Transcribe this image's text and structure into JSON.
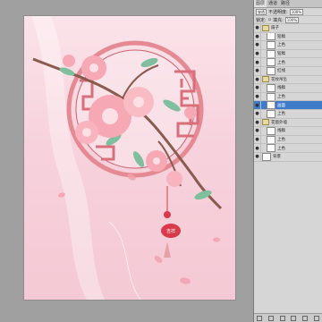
{
  "panel": {
    "tabs": [
      "图层",
      "通道",
      "路径"
    ],
    "blend_mode": "穿透",
    "opacity_label": "不透明度:",
    "opacity_value": "100%",
    "lock_label": "锁定:",
    "fill_label": "填充:",
    "fill_value": "100%",
    "layers": [
      {
        "name": "扇子",
        "type": "group",
        "indent": false,
        "selected": false
      },
      {
        "name": "铅稿",
        "type": "layer",
        "indent": true,
        "selected": false
      },
      {
        "name": "上色",
        "type": "layer",
        "indent": true,
        "selected": false
      },
      {
        "name": "铅稿",
        "type": "layer",
        "indent": true,
        "selected": false
      },
      {
        "name": "上色",
        "type": "layer",
        "indent": true,
        "selected": false
      },
      {
        "name": "红线",
        "type": "layer",
        "indent": true,
        "selected": false
      },
      {
        "name": "花纹吊坠",
        "type": "group",
        "indent": false,
        "selected": false
      },
      {
        "name": "线稿",
        "type": "layer",
        "indent": true,
        "selected": false
      },
      {
        "name": "上色",
        "type": "layer",
        "indent": true,
        "selected": false
      },
      {
        "name": "画面",
        "type": "layer",
        "indent": true,
        "selected": true
      },
      {
        "name": "上色",
        "type": "layer",
        "indent": true,
        "selected": false
      },
      {
        "name": "花窗外墙",
        "type": "group",
        "indent": false,
        "selected": false
      },
      {
        "name": "线稿",
        "type": "layer",
        "indent": true,
        "selected": false
      },
      {
        "name": "上色",
        "type": "layer",
        "indent": true,
        "selected": false
      },
      {
        "name": "上色",
        "type": "layer",
        "indent": true,
        "selected": false
      },
      {
        "name": "背景",
        "type": "layer",
        "indent": false,
        "selected": false
      }
    ]
  },
  "artwork": {
    "pendant_text": "吉祥",
    "colors": {
      "frame": "#e58a93",
      "frame_dark": "#c8626c",
      "blossom": "#f6a9b4",
      "blossom_light": "#fde0e5",
      "leaf": "#7fbf9d",
      "branch": "#8a5a4c",
      "pendant": "#d83a4a"
    }
  }
}
